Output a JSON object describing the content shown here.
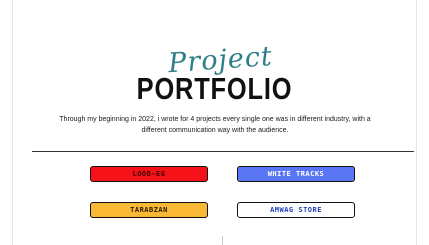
{
  "header": {
    "script_word": "Project",
    "title": "PORTFOLIO"
  },
  "intro": {
    "text": "Through my beginning in 2022, i wrote for 4 projects every single one was in different industry, with a different communication way with the audience."
  },
  "projects": [
    {
      "label": "LOOB-EG",
      "color": "#f41218"
    },
    {
      "label": "WHITE TRACKS",
      "color": "#5b76f5"
    },
    {
      "label": "TARABZAN",
      "color": "#f9b935"
    },
    {
      "label": "AMWAG STORE",
      "color": "#ffffff"
    }
  ]
}
